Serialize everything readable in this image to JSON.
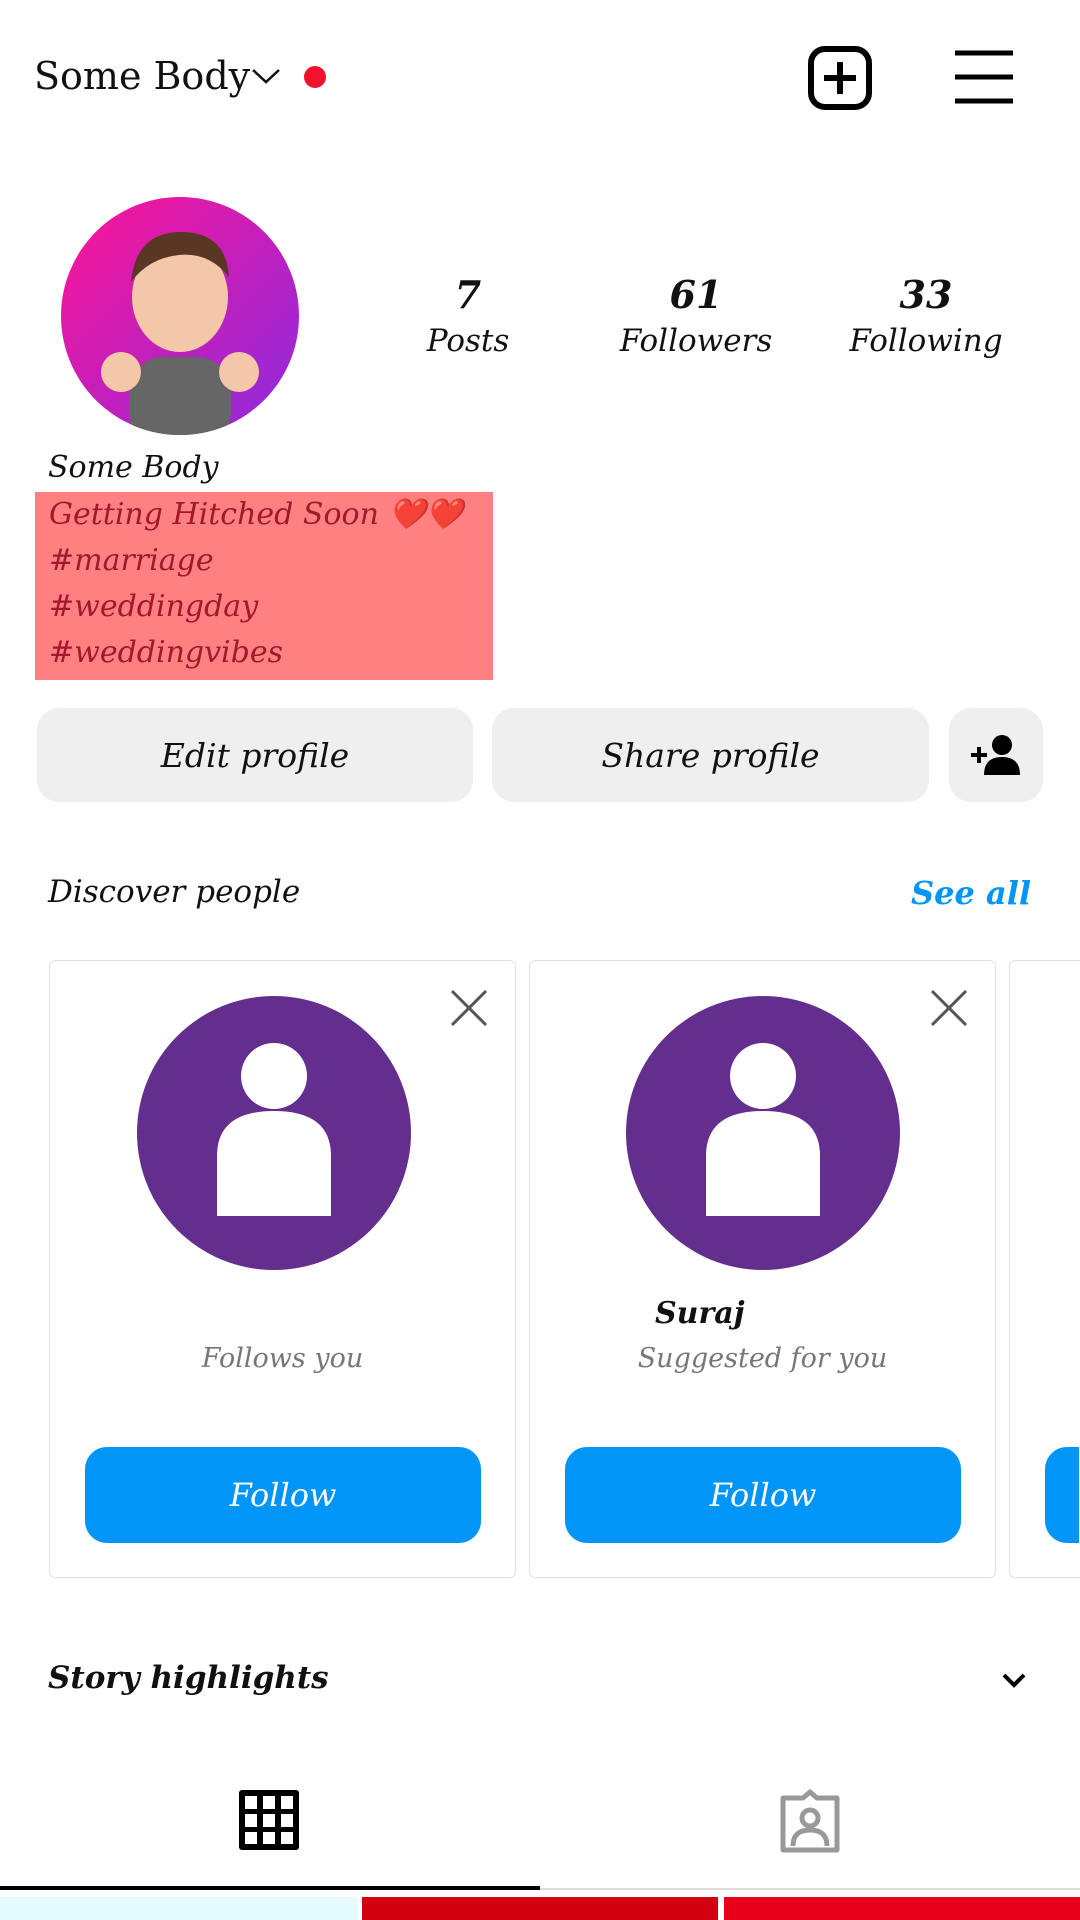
{
  "header": {
    "username": "Some Body",
    "new_post_icon": "plus-square-icon",
    "menu_icon": "hamburger-icon",
    "notification_dot_color": "#f0122c"
  },
  "stats": [
    {
      "value": "7",
      "label": "Posts"
    },
    {
      "value": "61",
      "label": "Followers"
    },
    {
      "value": "33",
      "label": "Following"
    }
  ],
  "profile": {
    "name": "Some Body",
    "bio": [
      "Getting Hitched Soon ❤️❤️",
      "#marriage",
      "#weddingday",
      "#weddingvibes"
    ],
    "bio_highlight_color": "#ff8080"
  },
  "actions": {
    "edit": "Edit profile",
    "share": "Share profile",
    "add_icon": "add-person-icon"
  },
  "discover": {
    "title": "Discover people",
    "see_all": "See all",
    "cards": [
      {
        "name": "",
        "subtitle": "Follows you",
        "button": "Follow"
      },
      {
        "name": "Suraj",
        "subtitle": "Suggested for you",
        "button": "Follow"
      }
    ]
  },
  "highlights": {
    "title": "Story highlights"
  },
  "tabs": [
    {
      "icon": "grid-icon",
      "active": true
    },
    {
      "icon": "tagged-icon",
      "active": false
    }
  ],
  "colors": {
    "accent": "#0095f6",
    "avatar_placeholder": "#642e8f"
  }
}
